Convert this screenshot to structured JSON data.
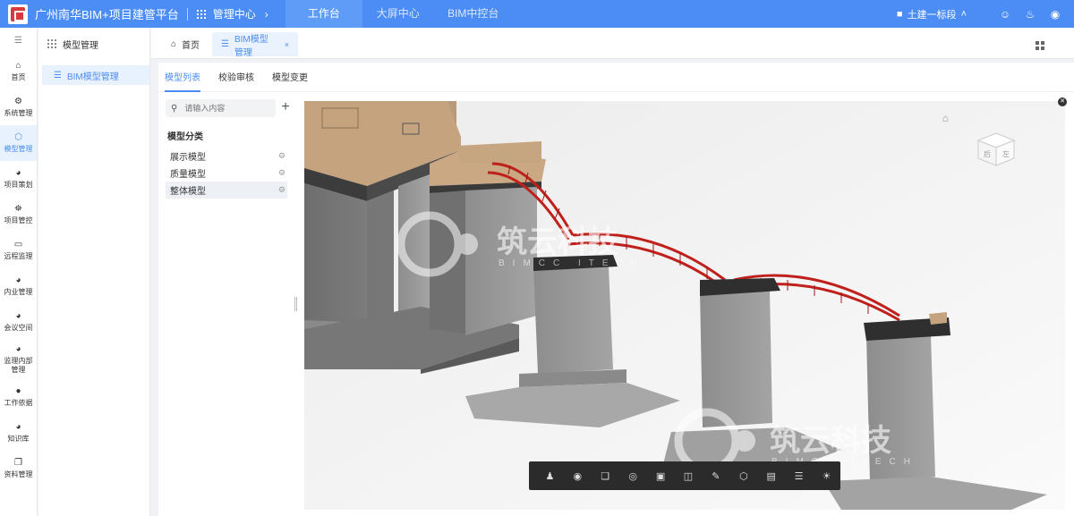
{
  "header": {
    "app_title": "广州南华BIM+项目建管平台",
    "center_title": "管理中心",
    "nav_tabs": [
      {
        "label": "工作台",
        "active": true
      },
      {
        "label": "大屏中心",
        "active": false
      },
      {
        "label": "BIM中控台",
        "active": false
      }
    ],
    "project": "土建一标段",
    "accent_color": "#4b8df5"
  },
  "sidebar": {
    "items": [
      {
        "label": "首页",
        "icon": "home-icon"
      },
      {
        "label": "系统管理",
        "icon": "gear-icon"
      },
      {
        "label": "模型管理",
        "icon": "cube-icon",
        "active": true
      },
      {
        "label": "项目策划",
        "icon": "compass-icon"
      },
      {
        "label": "项目管控",
        "icon": "helmet-icon"
      },
      {
        "label": "远程监理",
        "icon": "monitor-icon"
      },
      {
        "label": "内业管理",
        "icon": "compass-icon"
      },
      {
        "label": "会议空间",
        "icon": "compass-icon"
      },
      {
        "label": "监理内部管理",
        "icon": "compass-icon"
      },
      {
        "label": "工作依据",
        "icon": "pin-icon"
      },
      {
        "label": "知识库",
        "icon": "compass-icon"
      },
      {
        "label": "资料管理",
        "icon": "copy-icon"
      }
    ]
  },
  "submenu": {
    "title": "模型管理",
    "items": [
      {
        "label": "BIM模型管理",
        "active": true
      }
    ]
  },
  "page_tabs": [
    {
      "label": "首页"
    },
    {
      "label": "BIM模型管理",
      "active": true
    }
  ],
  "content": {
    "subtabs": [
      {
        "label": "模型列表",
        "active": true
      },
      {
        "label": "校验审核"
      },
      {
        "label": "模型变更"
      }
    ],
    "search_placeholder": "请输入内容",
    "tree_title": "模型分类",
    "tree_items": [
      {
        "label": "展示模型"
      },
      {
        "label": "质量模型"
      },
      {
        "label": "整体模型",
        "active": true
      }
    ]
  },
  "viewer": {
    "watermark_cn": "筑云科技",
    "watermark_en": "BIMCC ITECH",
    "viewcube_faces": [
      "后",
      "左"
    ],
    "toolbar_icons": [
      "walk-icon",
      "eye-icon",
      "layers-icon",
      "focus-icon",
      "fit-icon",
      "section-icon",
      "measure-icon",
      "cube-icon",
      "box-icon",
      "properties-icon",
      "palette-icon"
    ]
  }
}
